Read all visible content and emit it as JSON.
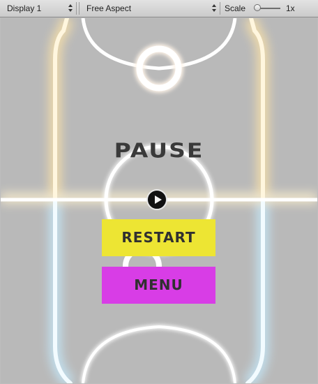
{
  "toolbar": {
    "display": "Display 1",
    "aspect": "Free Aspect",
    "scale_label": "Scale",
    "scale_value": "1x",
    "scale_level": 0
  },
  "pause": {
    "title": "PAUSE",
    "restart_label": "RESTART",
    "menu_label": "MENU"
  },
  "colors": {
    "restart": "#ede533",
    "menu": "#d83de6",
    "top_glow": "#ffe7b0",
    "bottom_glow": "#bfe9ff"
  },
  "icons": [
    "dropdown-arrows-icon",
    "play-icon"
  ]
}
